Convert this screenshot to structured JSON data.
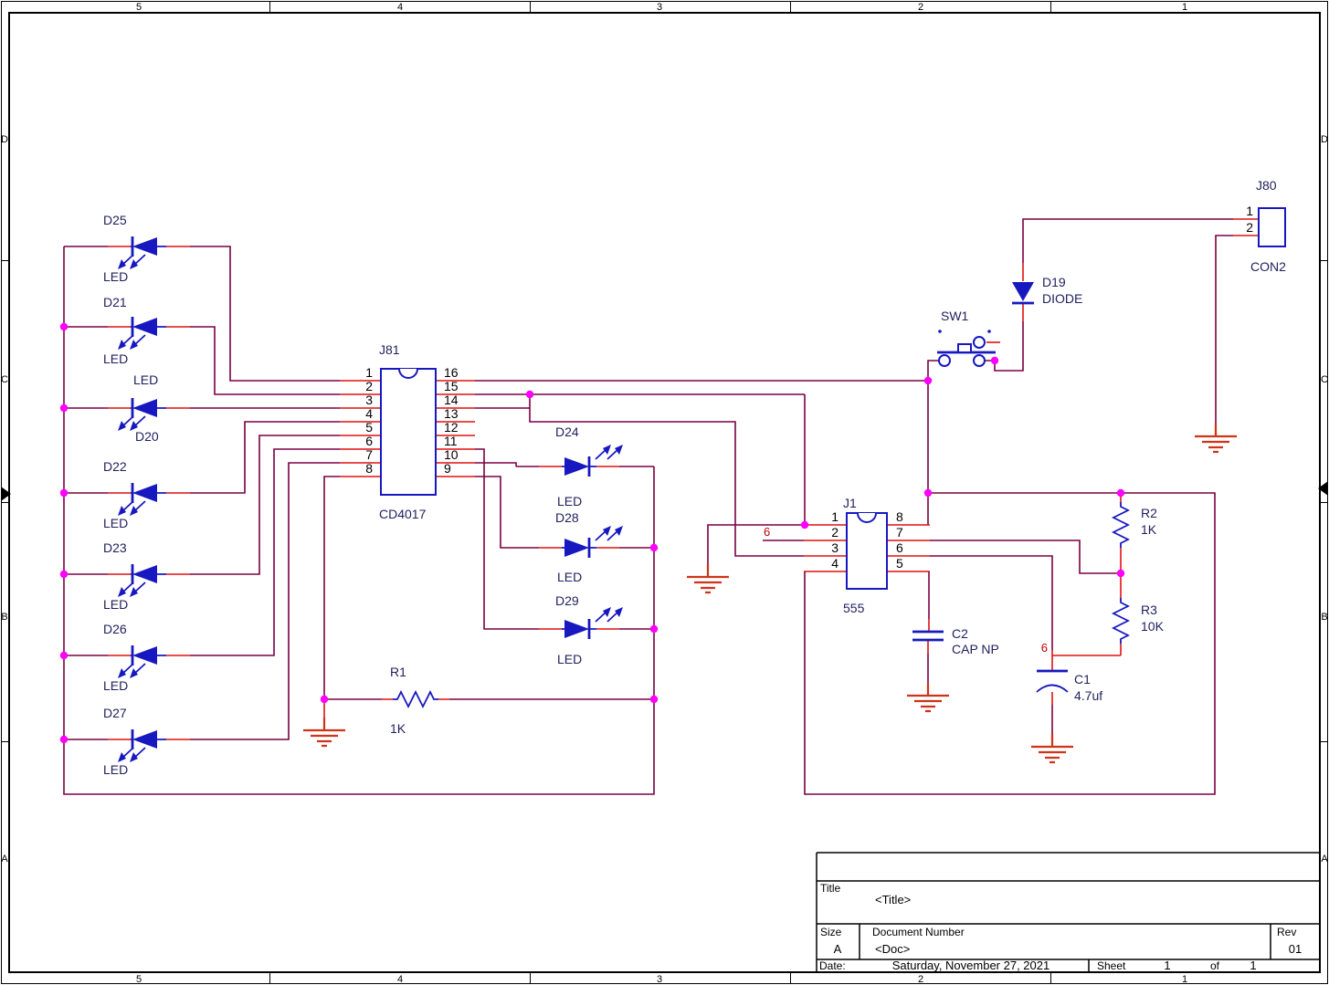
{
  "border": {
    "cols": [
      "5",
      "4",
      "3",
      "2",
      "1"
    ],
    "rows": [
      "D",
      "C",
      "B",
      "A"
    ]
  },
  "title_block": {
    "title_label": "Title",
    "title_value": "<Title>",
    "size_label": "Size",
    "size_value": "A",
    "doc_label": "Document Number",
    "doc_value": "<Doc>",
    "rev_label": "Rev",
    "rev_value": "01",
    "date_label": "Date:",
    "date_value": "Saturday, November 27, 2021",
    "sheet_label": "Sheet",
    "sheet_num": "1",
    "of_label": "of",
    "sheet_total": "1"
  },
  "ics": {
    "j81": {
      "ref": "J81",
      "part": "CD4017",
      "pins_left": [
        "1",
        "2",
        "3",
        "4",
        "5",
        "6",
        "7",
        "8"
      ],
      "pins_right": [
        "16",
        "15",
        "14",
        "13",
        "12",
        "11",
        "10",
        "9"
      ]
    },
    "j1": {
      "ref": "J1",
      "part": "555",
      "pins_left": [
        "1",
        "2",
        "3",
        "4"
      ],
      "pins_right": [
        "8",
        "7",
        "6",
        "5"
      ]
    }
  },
  "connector": {
    "ref": "J80",
    "part": "CON2",
    "pins": [
      "1",
      "2"
    ]
  },
  "switch": {
    "ref": "SW1"
  },
  "diode": {
    "ref": "D19",
    "part": "DIODE"
  },
  "resistors": {
    "r1": {
      "ref": "R1",
      "value": "1K"
    },
    "r2": {
      "ref": "R2",
      "value": "1K"
    },
    "r3": {
      "ref": "R3",
      "value": "10K"
    }
  },
  "capacitors": {
    "c1": {
      "ref": "C1",
      "value": "4.7uf"
    },
    "c2": {
      "ref": "C2",
      "value": "CAP NP"
    }
  },
  "left_leds": [
    {
      "ref": "D25",
      "type": "LED"
    },
    {
      "ref": "D21",
      "type": "LED"
    },
    {
      "ref": "D20",
      "type": "LED"
    },
    {
      "ref": "D22",
      "type": "LED"
    },
    {
      "ref": "D23",
      "type": "LED"
    },
    {
      "ref": "D26",
      "type": "LED"
    },
    {
      "ref": "D27",
      "type": "LED"
    }
  ],
  "mid_leds": [
    {
      "ref": "D24",
      "type": "LED"
    },
    {
      "ref": "D28",
      "type": "LED"
    },
    {
      "ref": "D29",
      "type": "LED"
    }
  ],
  "net_labels": {
    "a": "6",
    "b": "6"
  },
  "colors": {
    "wire": "#7a0043",
    "pin_stub": "#e01010",
    "component": "#1818c0",
    "label": "#1f1f5e",
    "junction": "#ff00ff",
    "ground": "#cf3318",
    "net": "#c00000"
  }
}
